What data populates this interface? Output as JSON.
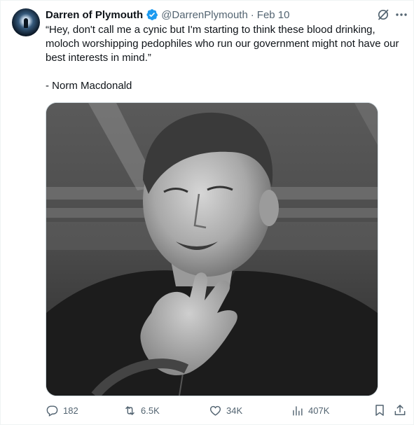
{
  "tweet": {
    "author_name": "Darren of Plymouth",
    "handle": "@DarrenPlymouth",
    "separator": "·",
    "date": "Feb 10",
    "text": "“Hey, don't call me a cynic but I'm starting to think these blood drinking, moloch worshipping pedophiles who run our government might not have our best interests in mind.”",
    "attribution": "- Norm Macdonald"
  },
  "metrics": {
    "replies": "182",
    "reposts": "6.5K",
    "likes": "34K",
    "views": "407K"
  },
  "icons": {
    "avatar": "avatar",
    "verified": "verified-badge-icon",
    "grok": "grok-icon",
    "more": "more-icon",
    "reply": "reply-icon",
    "repost": "repost-icon",
    "like": "like-icon",
    "views": "views-icon",
    "bookmark": "bookmark-icon",
    "share": "share-icon"
  },
  "colors": {
    "text": "#0f1419",
    "secondary": "#536471",
    "verified": "#1d9bf0",
    "border": "#cfd9de"
  }
}
